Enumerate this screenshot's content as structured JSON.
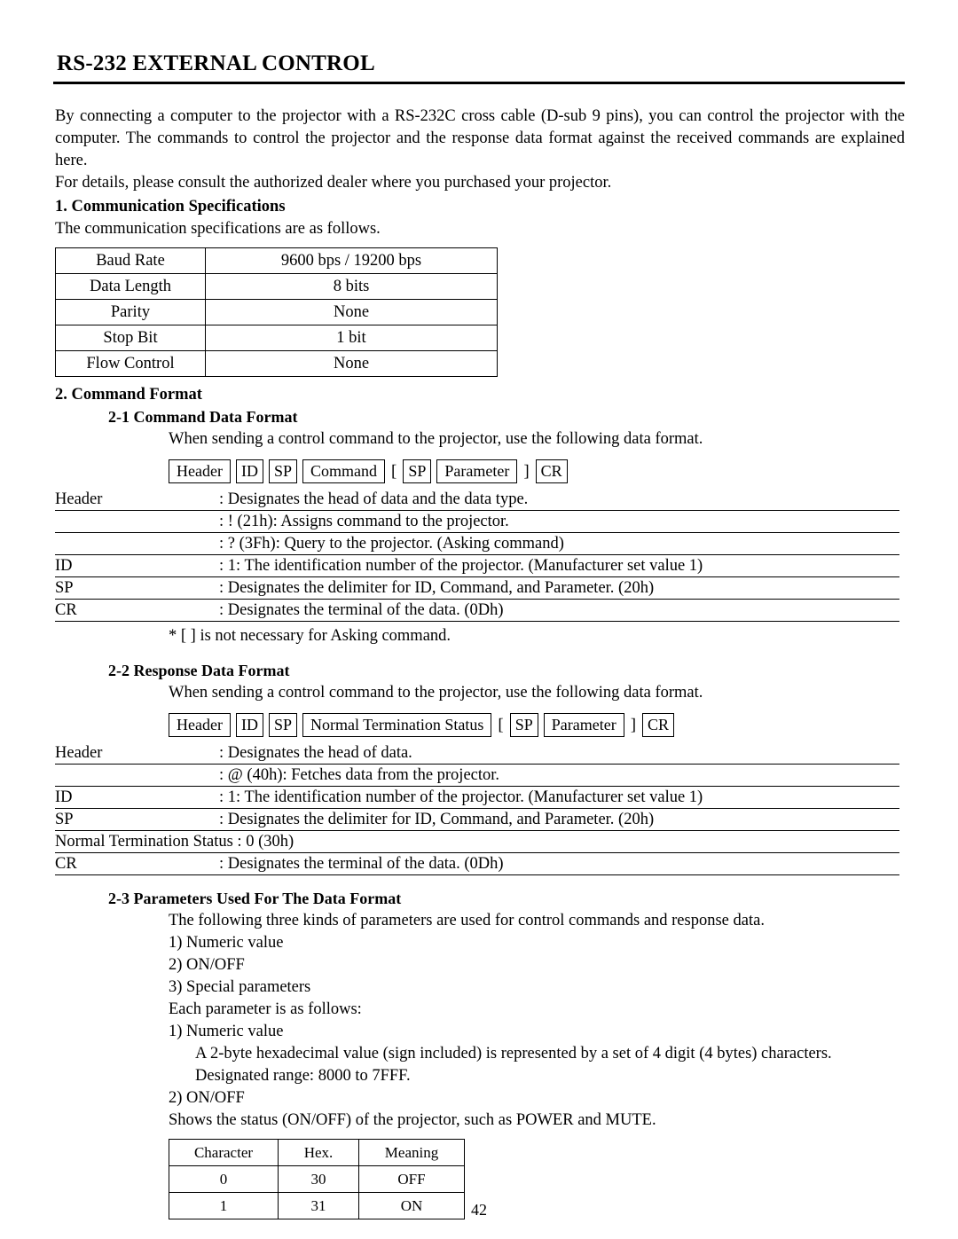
{
  "header": {
    "title": "RS-232 EXTERNAL CONTROL"
  },
  "intro": {
    "p1": "By connecting a computer to the projector with a RS-232C cross cable (D-sub 9 pins), you can control the projector with the computer. The commands to control the projector and the response data format against the received commands are explained here.",
    "p2": "For details, please consult the authorized dealer where you purchased your projector."
  },
  "section1": {
    "title": "1. Communication Specifications",
    "lead": "The communication specifications are as follows.",
    "table": {
      "rows": [
        {
          "label": "Baud Rate",
          "value": "9600 bps / 19200 bps"
        },
        {
          "label": "Data Length",
          "value": "8 bits"
        },
        {
          "label": "Parity",
          "value": "None"
        },
        {
          "label": "Stop Bit",
          "value": "1 bit"
        },
        {
          "label": "Flow Control",
          "value": "None"
        }
      ]
    }
  },
  "section2": {
    "title": "2. Command Format",
    "sub1": {
      "title": "2-1 Command Data Format",
      "lead": "When sending a control command to the projector, use the following data format.",
      "boxes": [
        "Header",
        "ID",
        "SP",
        "Command",
        "[",
        "SP",
        "Parameter",
        "]",
        "CR"
      ],
      "defs": [
        {
          "term": "Header",
          "desc": ": Designates the head of data and the data type."
        },
        {
          "term": "",
          "desc": ": ! (21h): Assigns command to the projector."
        },
        {
          "term": "",
          "desc": ": ? (3Fh): Query to the projector. (Asking command)"
        },
        {
          "term": "ID",
          "desc": ": 1: The identification number of the projector. (Manufacturer set value 1)"
        },
        {
          "term": "SP",
          "desc": ": Designates the delimiter for ID, Command, and Parameter. (20h)"
        },
        {
          "term": "CR",
          "desc": ": Designates the terminal of the data. (0Dh)"
        }
      ],
      "note": "* [    ] is not necessary for Asking command."
    },
    "sub2": {
      "title": "2-2 Response Data Format",
      "lead": "When sending a control command to the projector, use the following data format.",
      "boxes": [
        "Header",
        "ID",
        "SP",
        "Normal Termination Status",
        "[",
        "SP",
        "Parameter",
        "]",
        "CR"
      ],
      "defs": [
        {
          "term": "Header",
          "desc": ": Designates the head of data."
        },
        {
          "term": "",
          "desc": ": @ (40h): Fetches data from the projector."
        },
        {
          "term": "ID",
          "desc": ": 1: The identification number of the projector. (Manufacturer set value 1)"
        },
        {
          "term": "SP",
          "desc": ": Designates the delimiter for ID, Command, and Parameter. (20h)"
        },
        {
          "term": "Normal Termination Status : 0 (30h)",
          "desc": ""
        },
        {
          "term": "CR",
          "desc": ": Designates the terminal of the data. (0Dh)"
        }
      ]
    },
    "sub3": {
      "title": "2-3 Parameters Used For The Data Format",
      "lead": "The following three kinds of parameters are used for control commands and response data.",
      "list": [
        "1) Numeric value",
        "2) ON/OFF",
        "3) Special parameters"
      ],
      "each_lead": "Each parameter is as follows:",
      "item1_title": "1) Numeric value",
      "item1_body": "A 2-byte hexadecimal value (sign included) is represented by a set of 4 digit (4 bytes) characters.",
      "item1_body2": "Designated range: 8000 to 7FFF.",
      "item2_title": "2) ON/OFF",
      "item2_body": "Shows the status (ON/OFF) of the projector, such as POWER and MUTE.",
      "table": {
        "headers": [
          "Character",
          "Hex.",
          "Meaning"
        ],
        "rows": [
          [
            "0",
            "30",
            "OFF"
          ],
          [
            "1",
            "31",
            "ON"
          ]
        ]
      }
    }
  },
  "footer": {
    "page": "42"
  }
}
